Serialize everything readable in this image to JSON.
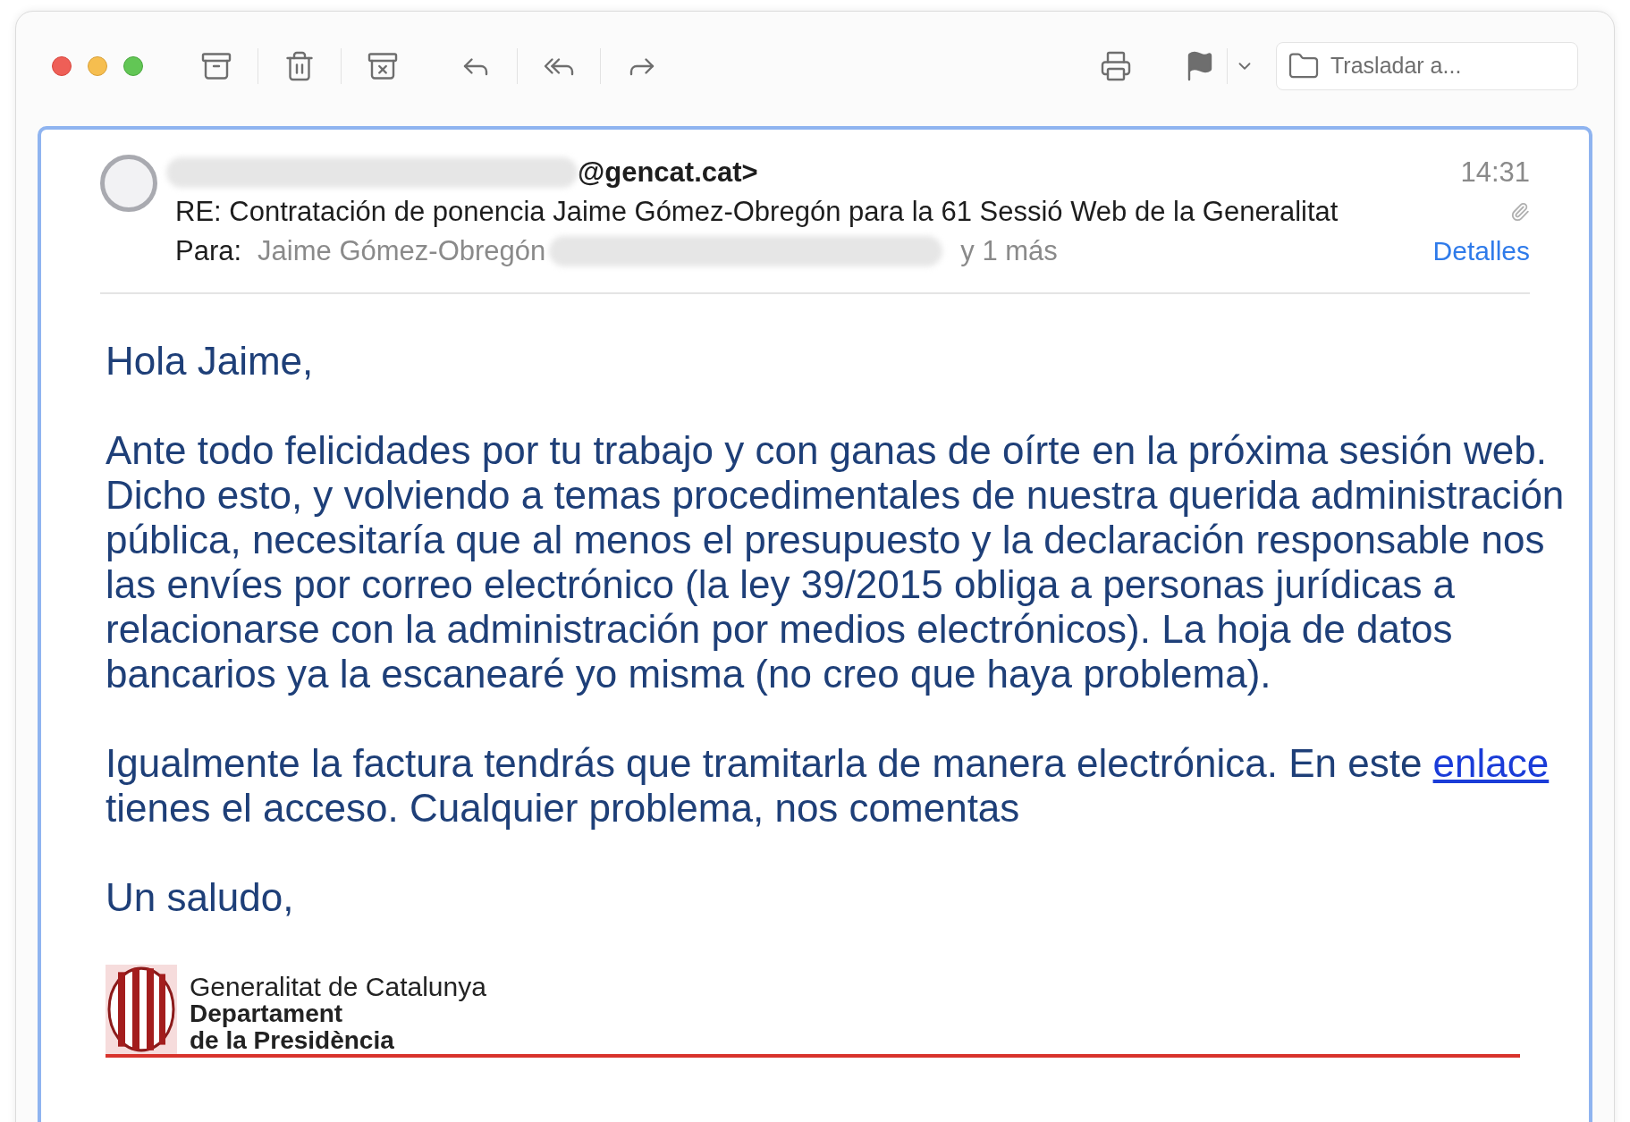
{
  "toolbar": {
    "move_button": {
      "label": "Trasladar a..."
    }
  },
  "message": {
    "sender": "@gencat.cat>",
    "time": "14:31",
    "subject": "RE: Contratación de ponencia Jaime Gómez-Obregón para la 61 Sessió Web de la Generalitat",
    "has_attachment": true,
    "to_label": "Para:",
    "recipient": "Jaime Gómez-Obregón",
    "more_recipients": "y 1 más",
    "details_link": "Detalles"
  },
  "body": [
    {
      "kind": "text",
      "text": "Hola Jaime,"
    },
    {
      "kind": "text",
      "text": "Ante todo felicidades por tu trabajo y con ganas de oírte en la próxima sesión web. Dicho esto, y volviendo a temas procedimentales de nuestra querida administración pública, necesitaría que al menos el presupuesto y la declaración responsable nos las envíes por correo electrónico (la ley 39/2015 obliga a personas jurídicas a relacionarse con la administración por medios electrónicos). La hoja de datos bancarios ya la escanearé yo misma (no creo que haya problema)."
    },
    {
      "kind": "linked",
      "before": "Igualmente la factura tendrás que tramitarla de manera electrónica. En este ",
      "link": "enlace",
      "after": " tienes el acceso. Cualquier problema, nos comentas"
    },
    {
      "kind": "text",
      "text": "Un saludo,"
    }
  ],
  "signature": {
    "line_1": "Generalitat de Catalunya",
    "line_2": "Departament",
    "line_3": "de la Presidència"
  }
}
